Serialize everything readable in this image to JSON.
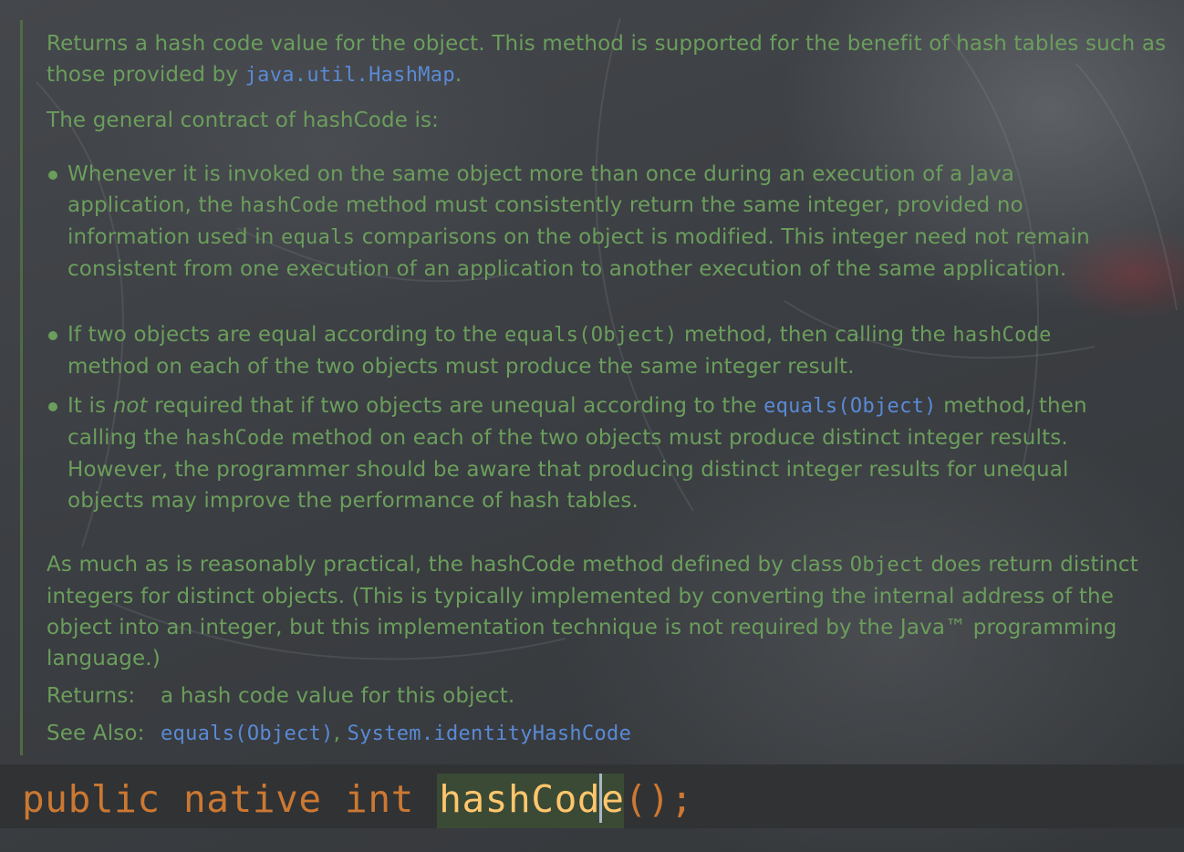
{
  "doc": {
    "p1": {
      "text_a": "Returns a hash code value for the object. This method is supported for the benefit of hash tables such as those provided by ",
      "link": "java.util.HashMap",
      "text_b": "."
    },
    "p2": {
      "text": "The general contract of hashCode is:"
    },
    "bullets": [
      {
        "a": "Whenever it is invoked on the same object more than once during an execution of a Java application, the ",
        "code1": "hashCode",
        "b": " method must consistently return the same integer, provided no information used in ",
        "code2": "equals",
        "c": " comparisons on the object is modified. This integer need not remain consistent from one execution of an application to another execution of the same application."
      },
      {
        "a": "If two objects are equal according to the ",
        "code1": "equals(Object)",
        "b": " method, then calling the ",
        "code2": "hashCode",
        "c": " method on each of the two objects must produce the same integer result."
      },
      {
        "a": "It is ",
        "em": "not",
        "b": " required that if two objects are unequal according to the ",
        "link": "equals(Object)",
        "c": " method, then calling the ",
        "code1": "hashCode",
        "d": " method on each of the two objects must produce distinct integer results. However, the programmer should be aware that producing distinct integer results for unequal objects may improve the performance of hash tables."
      }
    ],
    "p3": {
      "a": "As much as is reasonably practical, the hashCode method defined by class ",
      "code": "Object",
      "b": " does return distinct integers for distinct objects. (This is typically implemented by converting the internal address of the object into an integer, but this implementation technique is not required by the Java™ programming language.)"
    },
    "returns": {
      "label": "Returns:",
      "value": "a hash code value for this object."
    },
    "see_also": {
      "label": "See Also:",
      "links": [
        "equals(Object)",
        "System.identityHashCode"
      ],
      "separator": ", "
    }
  },
  "code": {
    "kw1": "public",
    "kw2": "native",
    "kw3": "int",
    "ident_a": "hashCod",
    "ident_b": "e",
    "tail": "();"
  },
  "colors": {
    "doc_text": "#6b9e5c",
    "link": "#5a8ad6",
    "keyword": "#cc7832",
    "identifier": "#ffc66d",
    "background": "#3a3d40"
  }
}
